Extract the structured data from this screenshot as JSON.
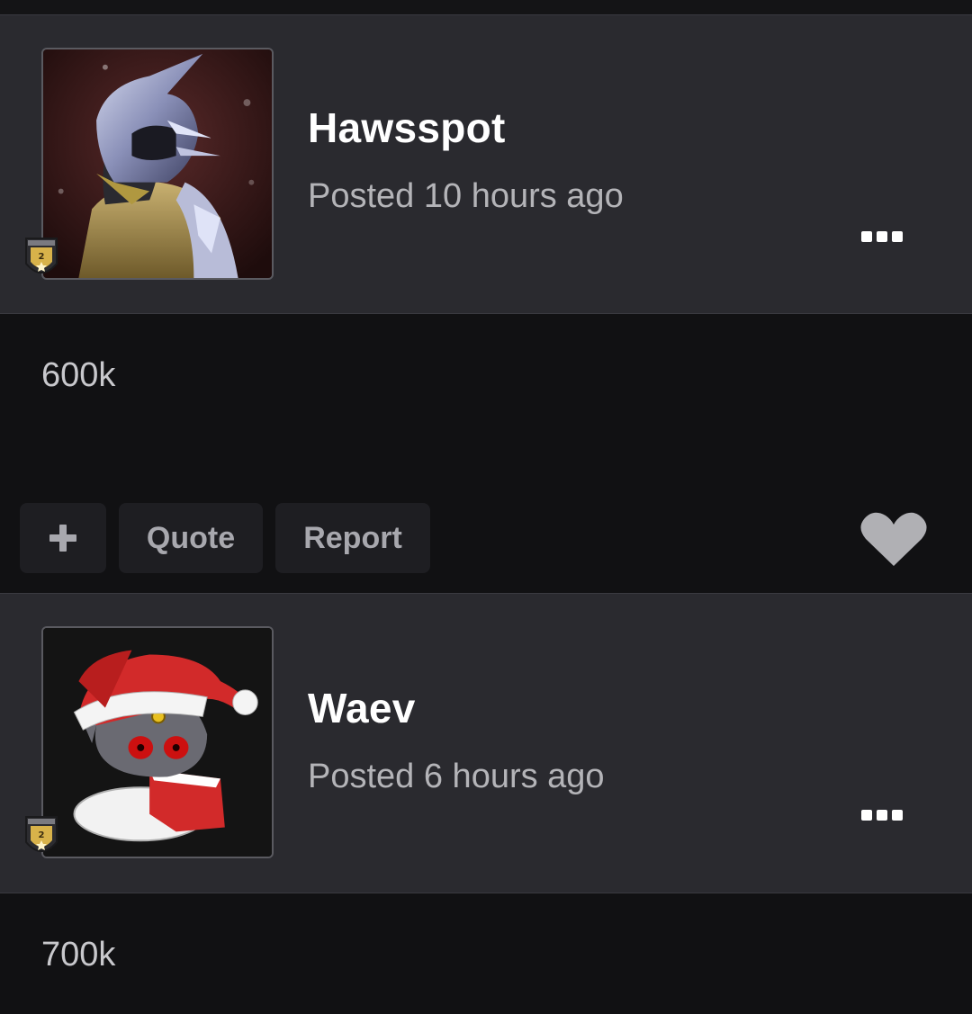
{
  "posts": [
    {
      "author": "Hawsspot",
      "posted": "Posted 10 hours ago",
      "body": "600k",
      "rank_badge_level": "2",
      "avatar_icon": "armored-warrior-avatar",
      "actions": {
        "plus_icon": "plus-icon",
        "quote_label": "Quote",
        "report_label": "Report",
        "like_icon": "heart-icon"
      }
    },
    {
      "author": "Waev",
      "posted": "Posted 6 hours ago",
      "body": "700k",
      "rank_badge_level": "2",
      "avatar_icon": "santa-hat-creature-avatar"
    }
  ],
  "colors": {
    "page_bg": "#111113",
    "header_bg": "#2a2a2f",
    "button_bg": "#1e1e22",
    "heart": "#b0b0b4",
    "author_text": "#ffffff",
    "meta_text": "#b4b4b8"
  }
}
